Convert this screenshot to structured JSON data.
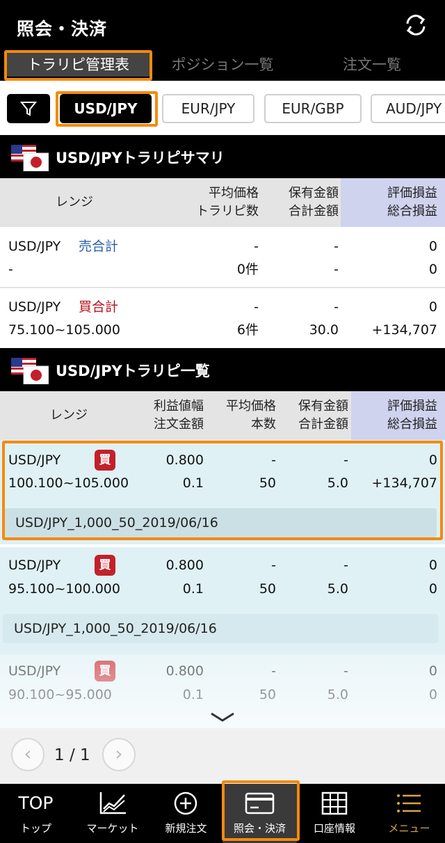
{
  "header": {
    "title": "照会・決済"
  },
  "tabs": [
    {
      "label": "トラリピ管理表"
    },
    {
      "label": "ポジション一覧"
    },
    {
      "label": "注文一覧"
    }
  ],
  "filters": {
    "pairs": [
      "USD/JPY",
      "EUR/JPY",
      "EUR/GBP",
      "AUD/JPY"
    ]
  },
  "summary": {
    "title": "USD/JPYトラリピサマリ",
    "columns": {
      "range": "レンジ",
      "avg_price": "平均価格",
      "trap_count": "トラリピ数",
      "holding_amount": "保有金額",
      "total_amount": "合計金額",
      "eval_pl": "評価損益",
      "total_pl": "総合損益"
    },
    "rows": [
      {
        "pair": "USD/JPY",
        "side": "売合計",
        "range": "-",
        "avg_price": "-",
        "count": "0件",
        "holding": "-",
        "total": "-",
        "eval_pl": "0",
        "total_pl": "0"
      },
      {
        "pair": "USD/JPY",
        "side": "買合計",
        "range": "75.100~105.000",
        "avg_price": "-",
        "count": "6件",
        "holding": "-",
        "total": "30.0",
        "eval_pl": "0",
        "total_pl": "+134,707"
      }
    ]
  },
  "list": {
    "title": "USD/JPYトラリピ一覧",
    "columns": {
      "range": "レンジ",
      "profit_width": "利益値幅",
      "order_amount": "注文金額",
      "avg_price": "平均価格",
      "count": "本数",
      "holding_amount": "保有金額",
      "total_amount": "合計金額",
      "eval_pl": "評価損益",
      "total_pl": "総合損益"
    },
    "rows": [
      {
        "pair": "USD/JPY",
        "side": "買",
        "range": "100.100~105.000",
        "profit_width": "0.800",
        "order_amount": "0.1",
        "avg_price": "-",
        "count": "50",
        "holding": "-",
        "total": "5.0",
        "eval_pl": "0",
        "total_pl": "+134,707",
        "name": "USD/JPY_1,000_50_2019/06/16"
      },
      {
        "pair": "USD/JPY",
        "side": "買",
        "range": "95.100~100.000",
        "profit_width": "0.800",
        "order_amount": "0.1",
        "avg_price": "-",
        "count": "50",
        "holding": "-",
        "total": "5.0",
        "eval_pl": "0",
        "total_pl": "0",
        "name": "USD/JPY_1,000_50_2019/06/16"
      },
      {
        "pair": "USD/JPY",
        "side": "買",
        "range": "90.100~95.000",
        "profit_width": "0.800",
        "order_amount": "0.1",
        "avg_price": "-",
        "count": "50",
        "holding": "-",
        "total": "5.0",
        "eval_pl": "0",
        "total_pl": "0"
      }
    ]
  },
  "pager": {
    "label": "1 / 1"
  },
  "nav": [
    {
      "label": "トップ",
      "icon_text": "TOP"
    },
    {
      "label": "マーケット"
    },
    {
      "label": "新規注文"
    },
    {
      "label": "照会・決済"
    },
    {
      "label": "口座情報"
    },
    {
      "label": "メニュー"
    }
  ],
  "colors": {
    "highlight": "#f48a0c",
    "buy": "#c4202a",
    "sell_text": "#2a5ea8",
    "menu": "#d9a441"
  }
}
